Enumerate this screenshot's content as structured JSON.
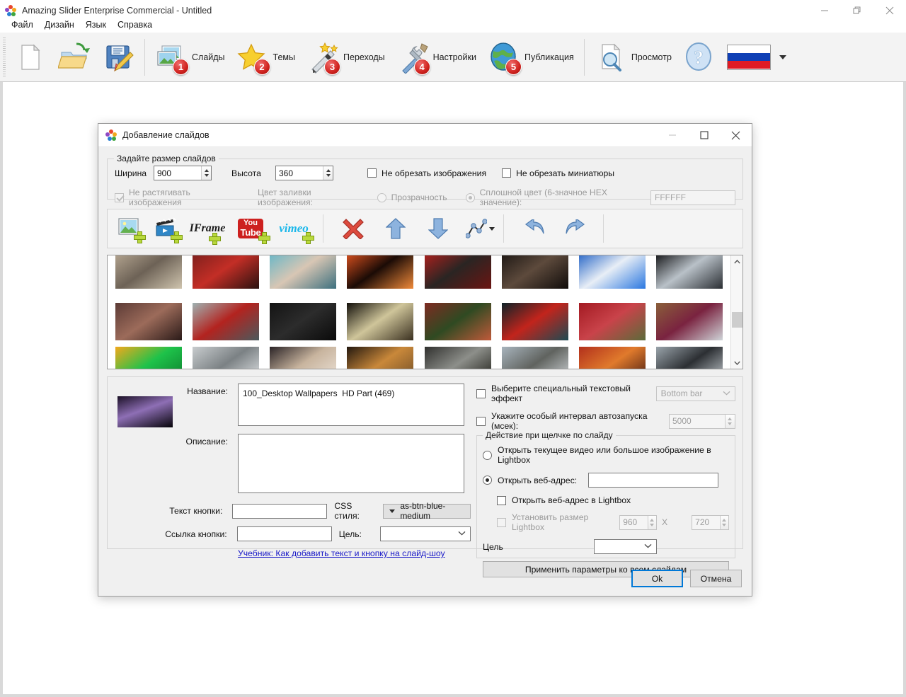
{
  "window": {
    "title": "Amazing Slider Enterprise Commercial - Untitled",
    "minimize": "–",
    "restore": "❐",
    "close": "✕"
  },
  "menubar": {
    "items": [
      {
        "label": "Файл"
      },
      {
        "label": "Дизайн"
      },
      {
        "label": "Язык"
      },
      {
        "label": "Справка"
      }
    ]
  },
  "ribbon": {
    "buttons": [
      {
        "name": "new",
        "label": "",
        "badge": ""
      },
      {
        "name": "open",
        "label": "",
        "badge": ""
      },
      {
        "name": "save",
        "label": "",
        "badge": ""
      },
      {
        "name": "slides",
        "label": "Слайды",
        "badge": "1"
      },
      {
        "name": "themes",
        "label": "Темы",
        "badge": "2"
      },
      {
        "name": "transitions",
        "label": "Переходы",
        "badge": "3"
      },
      {
        "name": "settings",
        "label": "Настройки",
        "badge": "4"
      },
      {
        "name": "publish",
        "label": "Публикация",
        "badge": "5"
      },
      {
        "name": "preview",
        "label": "Просмотр",
        "badge": ""
      },
      {
        "name": "help",
        "label": "",
        "badge": ""
      }
    ],
    "language_flag": "RU"
  },
  "dialog": {
    "title": "Добавление слайдов",
    "minimize": "–",
    "maximize": "☐",
    "close": "✕",
    "size_group": {
      "legend": "Задайте размер слайдов",
      "width_label": "Ширина",
      "width_value": "900",
      "height_label": "Высота",
      "height_value": "360",
      "no_crop_images": "Не обрезать изображения",
      "no_crop_thumbs": "Не обрезать миниатюры",
      "no_stretch_images": "Не растягивать изображения",
      "fill_color_label": "Цвет заливки изображения:",
      "transparency": "Прозрачность",
      "solid_color": "Сплошной цвет (6-значное HEX значение):",
      "hex_value": "FFFFFF"
    },
    "media_toolbar": {
      "buttons": [
        {
          "name": "add-image",
          "label": ""
        },
        {
          "name": "add-video",
          "label": ""
        },
        {
          "name": "add-iframe",
          "label": "IFrame"
        },
        {
          "name": "add-youtube",
          "label": "You Tube"
        },
        {
          "name": "add-vimeo",
          "label": "vimeo"
        },
        {
          "name": "delete",
          "label": ""
        },
        {
          "name": "move-up",
          "label": ""
        },
        {
          "name": "move-down",
          "label": ""
        },
        {
          "name": "sort",
          "label": ""
        },
        {
          "name": "undo",
          "label": ""
        },
        {
          "name": "redo",
          "label": ""
        }
      ]
    },
    "scrollbar": {
      "up": "⌃",
      "down": "⌄"
    },
    "details": {
      "title_label": "Название:",
      "title_value": "100_Desktop Wallpapers  HD Part (469)",
      "description_label": "Описание:",
      "description_value": "",
      "button_text_label": "Текст кнопки:",
      "button_text_value": "",
      "css_style_label": "CSS стиля:",
      "css_style_value": "as-btn-blue-medium",
      "button_link_label": "Ссылка кнопки:",
      "button_link_value": "",
      "target_label": "Цель:",
      "target_value": "",
      "tutorial_link": "Учебник: Как добавить текст и кнопку на слайд-шоу"
    },
    "right_panel": {
      "text_effect_checkbox": "Выберите специальный текстовый эффект",
      "text_effect_value": "Bottom bar",
      "autoplay_checkbox": "Укажите особый интервал автозапуска (мсек):",
      "autoplay_value": "5000",
      "click_action_legend": "Действие при щелчке по слайду",
      "open_lightbox_radio": "Открыть текущее видео или большое изображение в Lightbox",
      "open_url_radio": "Открыть веб-адрес:",
      "open_url_value": "",
      "open_url_in_lightbox": "Открыть веб-адрес в Lightbox",
      "set_lightbox_size": "Установить размер Lightbox",
      "lightbox_width": "960",
      "lightbox_x": "X",
      "lightbox_height": "720",
      "target_label": "Цель",
      "target_value": "",
      "apply_all_button": "Применить параметры ко всем слайдам"
    },
    "footer": {
      "ok": "Ok",
      "cancel": "Отмена"
    }
  },
  "thumbnails": {
    "rows": [
      [
        {
          "name": "desert-road",
          "c1": "#b7a893",
          "c2": "#6d6256",
          "c3": "#cfc4ae"
        },
        {
          "name": "red-car-wheel",
          "c1": "#7a1f1c",
          "c2": "#c32e26",
          "c3": "#2a1210"
        },
        {
          "name": "woman-pool",
          "c1": "#63b6c8",
          "c2": "#d8c6b4",
          "c3": "#3c6f7e"
        },
        {
          "name": "red-speedometer",
          "c1": "#e2531f",
          "c2": "#1b0b06",
          "c3": "#f08a3a"
        },
        {
          "name": "red-sportscar",
          "c1": "#b4201d",
          "c2": "#2a2523",
          "c3": "#6b1512"
        },
        {
          "name": "dark-hands",
          "c1": "#1a1512",
          "c2": "#5d4a3c",
          "c3": "#100c0a"
        },
        {
          "name": "football-goal",
          "c1": "#1d5fc4",
          "c2": "#e8eef6",
          "c3": "#2a77e0"
        },
        {
          "name": "smoke-hands",
          "c1": "#0b0b0d",
          "c2": "#b9c1c8",
          "c3": "#2a2e33"
        }
      ],
      [
        {
          "name": "fantasy-dolls",
          "c1": "#5c3b36",
          "c2": "#9c6b5a",
          "c3": "#2a1a18"
        },
        {
          "name": "red-car-reflection",
          "c1": "#9fb2b2",
          "c2": "#b3231f",
          "c3": "#4a5a5d"
        },
        {
          "name": "dark-stripes",
          "c1": "#141414",
          "c2": "#2c2c2c",
          "c3": "#0a0a0a"
        },
        {
          "name": "night-road-light",
          "c1": "#120f0a",
          "c2": "#cfc59a",
          "c3": "#3a3020"
        },
        {
          "name": "redhead-woman",
          "c1": "#7e2b22",
          "c2": "#2f4a22",
          "c3": "#c05a3a"
        },
        {
          "name": "dark-car-lights",
          "c1": "#0e2328",
          "c2": "#c2241c",
          "c3": "#1d4a52"
        },
        {
          "name": "red-flowers",
          "c1": "#a31a22",
          "c2": "#c9434a",
          "c3": "#5b6b3a"
        },
        {
          "name": "girl-headphones",
          "c1": "#8a5f3a",
          "c2": "#7a2340",
          "c3": "#cfd4d8"
        }
      ],
      [
        {
          "name": "green-gold-lake",
          "c1": "#f2a81c",
          "c2": "#1ec24a",
          "c3": "#0c7a2c"
        },
        {
          "name": "white-motorcycle",
          "c1": "#c8ccce",
          "c2": "#7b8184",
          "c3": "#e9ecee"
        },
        {
          "name": "brunette-woman",
          "c1": "#2a2326",
          "c2": "#c8b49e",
          "c3": "#efe6dc"
        },
        {
          "name": "saxophone-player",
          "c1": "#23180f",
          "c2": "#c9883a",
          "c3": "#6a4a26"
        },
        {
          "name": "revolver-gun",
          "c1": "#30302e",
          "c2": "#8d8f8a",
          "c3": "#15150f"
        },
        {
          "name": "bird-blur",
          "c1": "#a8b4bd",
          "c2": "#60635f",
          "c3": "#d8dde1"
        },
        {
          "name": "red-canyon-sunset",
          "c1": "#b2301c",
          "c2": "#e07a2c",
          "c3": "#3c1510"
        },
        {
          "name": "motorcycle-road",
          "c1": "#9aa4ab",
          "c2": "#2c2f33",
          "c3": "#cdd4d9"
        }
      ]
    ],
    "preview": {
      "name": "night-sky-tree",
      "c1": "#1b1026",
      "c2": "#8e6fb5",
      "c3": "#060409"
    }
  }
}
